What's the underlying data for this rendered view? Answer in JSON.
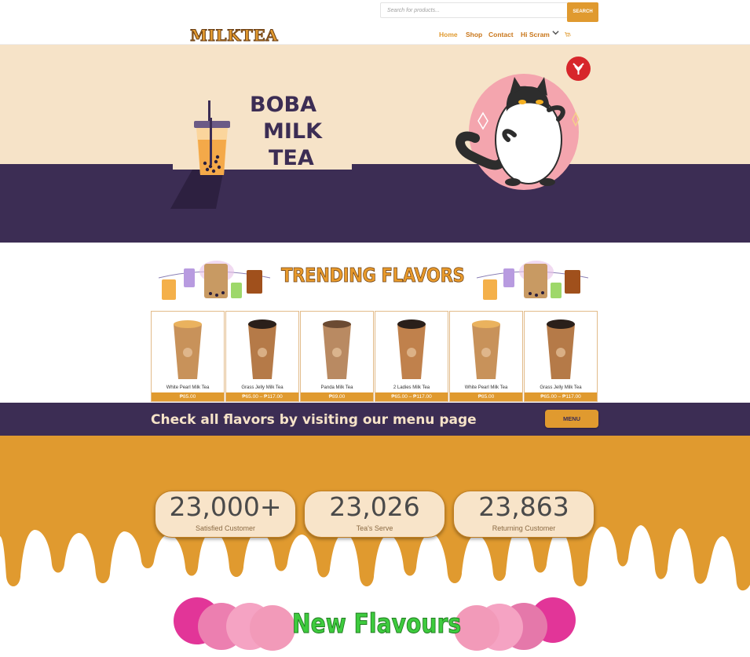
{
  "header": {
    "logo": "MILKTEA",
    "search_placeholder": "Search for products...",
    "search_button": "SEARCH",
    "nav": [
      {
        "label": "Home",
        "active": true
      },
      {
        "label": "Shop",
        "active": false
      },
      {
        "label": "Contact",
        "active": false
      },
      {
        "label": "Hi Scram",
        "active": false
      }
    ],
    "cart_count": "1"
  },
  "hero": {
    "title_lines": [
      "BOBA",
      "MILK",
      "TEA"
    ],
    "background_top": "#f6e3c8",
    "background_bottom": "#3c2d54"
  },
  "trending": {
    "title": "TRENDING FLAVORS",
    "products": [
      {
        "name": "White Pearl Milk Tea",
        "price": "₱85.00"
      },
      {
        "name": "Grass Jelly Milk Tea",
        "price": "₱65.00 – ₱117.00"
      },
      {
        "name": "Panda Milk Tea",
        "price": "₱89.00"
      },
      {
        "name": "2 Ladies Milk Tea",
        "price": "₱65.00 – ₱117.00"
      },
      {
        "name": "White Pearl Milk Tea",
        "price": "₱85.00"
      },
      {
        "name": "Grass Jelly Milk Tea",
        "price": "₱65.00 – ₱117.00"
      }
    ]
  },
  "cta": {
    "text": "Check all flavors by visiting our menu page",
    "button": "MENU"
  },
  "stats": [
    {
      "number": "23,000+",
      "label": "Satisfied Customer"
    },
    {
      "number": "23,026",
      "label": "Tea's Serve"
    },
    {
      "number": "23,863",
      "label": "Returning Customer"
    }
  ],
  "new_flavours": {
    "title": "New Flavours"
  },
  "colors": {
    "accent": "#e09a2f",
    "purple": "#3c2d54",
    "cream": "#f6e3c8",
    "green": "#3ecb3e",
    "pink": "#e8358e"
  }
}
